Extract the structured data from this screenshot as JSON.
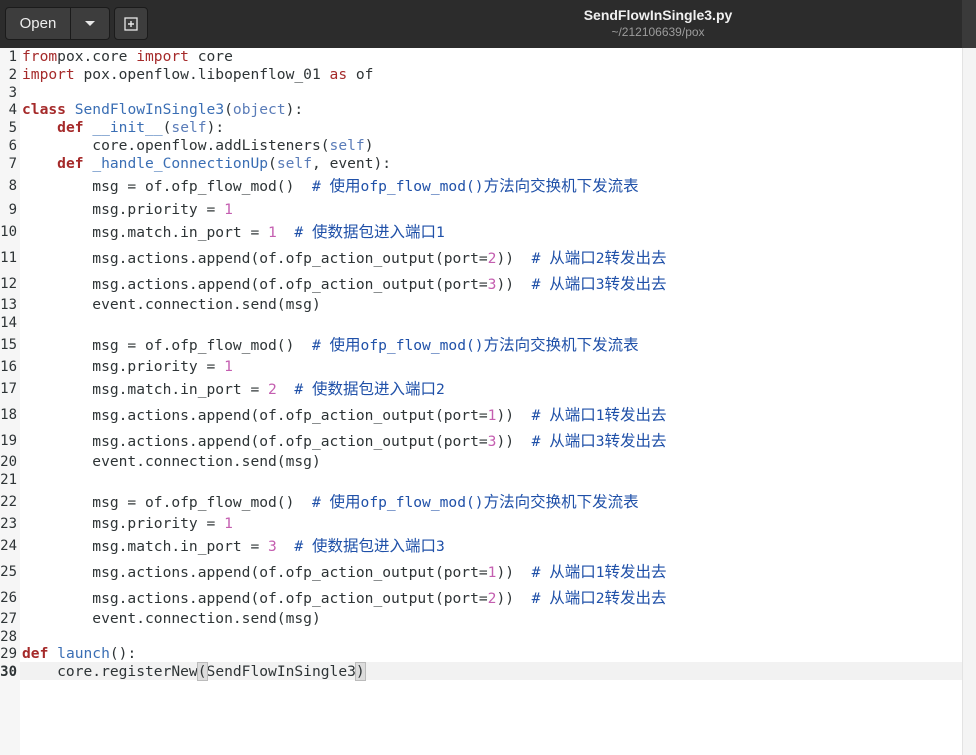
{
  "toolbar": {
    "open_label": "Open",
    "menu_icon": "chevron-down-icon",
    "new_icon": "new-document-icon"
  },
  "window": {
    "title": "SendFlowInSingle3.py",
    "path": "~/212106639/pox"
  },
  "editor": {
    "current_line": 30,
    "lines": [
      {
        "n": "1",
        "t": [
          [
            "kw2",
            "from"
          ],
          [
            "",
            "pox.core "
          ],
          [
            "kw2",
            "import"
          ],
          [
            "",
            " core"
          ]
        ]
      },
      {
        "n": "2",
        "t": [
          [
            "kw2",
            "import"
          ],
          [
            "",
            " pox.openflow.libopenflow_01 "
          ],
          [
            "kw2",
            "as"
          ],
          [
            "",
            " of"
          ]
        ]
      },
      {
        "n": "3",
        "t": []
      },
      {
        "n": "4",
        "t": [
          [
            "kw",
            "class"
          ],
          [
            "",
            " "
          ],
          [
            "fn",
            "SendFlowInSingle3"
          ],
          [
            "",
            "("
          ],
          [
            "bi",
            "object"
          ],
          [
            "",
            "):"
          ]
        ]
      },
      {
        "n": "5",
        "t": [
          [
            "",
            "    "
          ],
          [
            "kw",
            "def"
          ],
          [
            "",
            " "
          ],
          [
            "fn",
            "__init__"
          ],
          [
            "",
            "("
          ],
          [
            "bi",
            "self"
          ],
          [
            "",
            "):"
          ]
        ]
      },
      {
        "n": "6",
        "t": [
          [
            "",
            "        core.openflow.addListeners("
          ],
          [
            "bi",
            "self"
          ],
          [
            "",
            ")"
          ]
        ]
      },
      {
        "n": "7",
        "t": [
          [
            "",
            "    "
          ],
          [
            "kw",
            "def"
          ],
          [
            "",
            " "
          ],
          [
            "fn",
            "_handle_ConnectionUp"
          ],
          [
            "",
            "("
          ],
          [
            "bi",
            "self"
          ],
          [
            "",
            ", event):"
          ]
        ]
      },
      {
        "n": "8",
        "t": [
          [
            "",
            "        msg = of.ofp_flow_mod()  "
          ],
          [
            "cm",
            "# 使用ofp_flow_mod()方法向交换机下发流表"
          ]
        ]
      },
      {
        "n": "9",
        "t": [
          [
            "",
            "        msg.priority = "
          ],
          [
            "num",
            "1"
          ]
        ]
      },
      {
        "n": "10",
        "t": [
          [
            "",
            "        msg.match.in_port = "
          ],
          [
            "num",
            "1"
          ],
          [
            "",
            "  "
          ],
          [
            "cm",
            "# 使数据包进入端口1"
          ]
        ]
      },
      {
        "n": "11",
        "t": [
          [
            "",
            "        msg.actions.append(of.ofp_action_output(port="
          ],
          [
            "num",
            "2"
          ],
          [
            "",
            "))  "
          ],
          [
            "cm",
            "# 从端口2转发出去"
          ]
        ]
      },
      {
        "n": "12",
        "t": [
          [
            "",
            "        msg.actions.append(of.ofp_action_output(port="
          ],
          [
            "num",
            "3"
          ],
          [
            "",
            "))  "
          ],
          [
            "cm",
            "# 从端口3转发出去"
          ]
        ]
      },
      {
        "n": "13",
        "t": [
          [
            "",
            "        event.connection.send(msg)"
          ]
        ]
      },
      {
        "n": "14",
        "t": []
      },
      {
        "n": "15",
        "t": [
          [
            "",
            "        msg = of.ofp_flow_mod()  "
          ],
          [
            "cm",
            "# 使用ofp_flow_mod()方法向交换机下发流表"
          ]
        ]
      },
      {
        "n": "16",
        "t": [
          [
            "",
            "        msg.priority = "
          ],
          [
            "num",
            "1"
          ]
        ]
      },
      {
        "n": "17",
        "t": [
          [
            "",
            "        msg.match.in_port = "
          ],
          [
            "num",
            "2"
          ],
          [
            "",
            "  "
          ],
          [
            "cm",
            "# 使数据包进入端口2"
          ]
        ]
      },
      {
        "n": "18",
        "t": [
          [
            "",
            "        msg.actions.append(of.ofp_action_output(port="
          ],
          [
            "num",
            "1"
          ],
          [
            "",
            "))  "
          ],
          [
            "cm",
            "# 从端口1转发出去"
          ]
        ]
      },
      {
        "n": "19",
        "t": [
          [
            "",
            "        msg.actions.append(of.ofp_action_output(port="
          ],
          [
            "num",
            "3"
          ],
          [
            "",
            "))  "
          ],
          [
            "cm",
            "# 从端口3转发出去"
          ]
        ]
      },
      {
        "n": "20",
        "t": [
          [
            "",
            "        event.connection.send(msg)"
          ]
        ]
      },
      {
        "n": "21",
        "t": []
      },
      {
        "n": "22",
        "t": [
          [
            "",
            "        msg = of.ofp_flow_mod()  "
          ],
          [
            "cm",
            "# 使用ofp_flow_mod()方法向交换机下发流表"
          ]
        ]
      },
      {
        "n": "23",
        "t": [
          [
            "",
            "        msg.priority = "
          ],
          [
            "num",
            "1"
          ]
        ]
      },
      {
        "n": "24",
        "t": [
          [
            "",
            "        msg.match.in_port = "
          ],
          [
            "num",
            "3"
          ],
          [
            "",
            "  "
          ],
          [
            "cm",
            "# 使数据包进入端口3"
          ]
        ]
      },
      {
        "n": "25",
        "t": [
          [
            "",
            "        msg.actions.append(of.ofp_action_output(port="
          ],
          [
            "num",
            "1"
          ],
          [
            "",
            "))  "
          ],
          [
            "cm",
            "# 从端口1转发出去"
          ]
        ]
      },
      {
        "n": "26",
        "t": [
          [
            "",
            "        msg.actions.append(of.ofp_action_output(port="
          ],
          [
            "num",
            "2"
          ],
          [
            "",
            "))  "
          ],
          [
            "cm",
            "# 从端口2转发出去"
          ]
        ]
      },
      {
        "n": "27",
        "t": [
          [
            "",
            "        event.connection.send(msg)"
          ]
        ]
      },
      {
        "n": "28",
        "t": []
      },
      {
        "n": "29",
        "t": [
          [
            "kw",
            "def"
          ],
          [
            "",
            " "
          ],
          [
            "fn",
            "launch"
          ],
          [
            "",
            "():"
          ]
        ]
      },
      {
        "n": "30",
        "t": [
          [
            "",
            "    core.registerNew"
          ],
          [
            "br",
            "("
          ],
          [
            "",
            "SendFlowInSingle3"
          ],
          [
            "br",
            ")"
          ]
        ]
      }
    ]
  },
  "colors": {
    "keyword": "#a52a2a",
    "function": "#3a6eb4",
    "builtin": "#5a7cb8",
    "number": "#c45eb0",
    "comment": "#1f50a8",
    "header_bg": "#2c2c2c"
  }
}
